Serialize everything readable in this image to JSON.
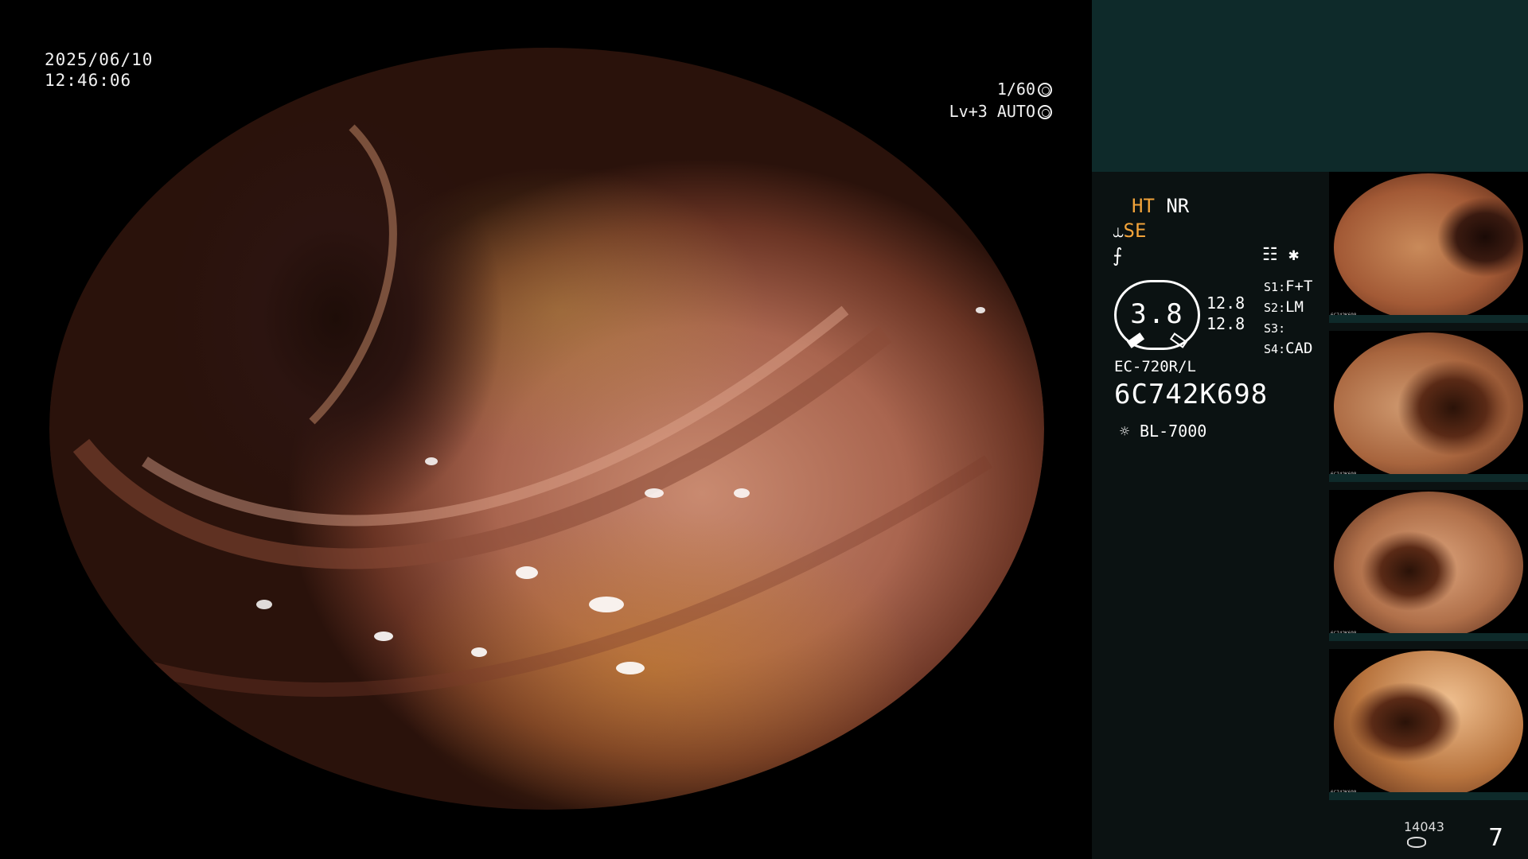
{
  "overlay": {
    "date": "2025/06/10",
    "time": "12:46:06",
    "shutter": "1/60",
    "level": "Lv+3 AUTO"
  },
  "panel": {
    "mode_ht": "HT",
    "mode_nr": "NR",
    "mode_se": "SE",
    "dial_value": "3.8",
    "dial_left": "12.8",
    "dial_right": "12.8",
    "slots": [
      {
        "key": "S1",
        "value": "F+T"
      },
      {
        "key": "S2",
        "value": "LM"
      },
      {
        "key": "S3",
        "value": ""
      },
      {
        "key": "S4",
        "value": "CAD"
      }
    ],
    "scope_model": "EC-720R/L",
    "scope_serial": "6C742K698",
    "light_source": "BL-7000",
    "storage_count": "14043",
    "page_number": "7"
  },
  "thumbnails": [
    {
      "id": "6C742K698"
    },
    {
      "id": "6C742K698"
    },
    {
      "id": "6C742K698"
    },
    {
      "id": "6C742K698"
    }
  ],
  "colors": {
    "panel_bg": "#0b1212",
    "panel_top": "#0e2a2a",
    "accent_orange": "#f2a33a"
  }
}
